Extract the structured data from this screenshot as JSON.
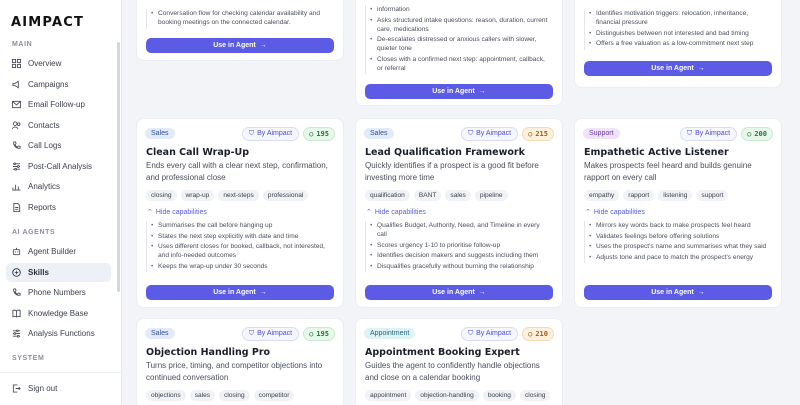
{
  "app": {
    "logo": "AIMPACT"
  },
  "sidebar": {
    "sections": {
      "main": "MAIN",
      "ai_agents": "AI AGENTS",
      "system": "SYSTEM"
    },
    "main_items": [
      {
        "label": "Overview",
        "icon": "grid-icon"
      },
      {
        "label": "Campaigns",
        "icon": "megaphone-icon"
      },
      {
        "label": "Email Follow-up",
        "icon": "mail-icon"
      },
      {
        "label": "Contacts",
        "icon": "users-icon"
      },
      {
        "label": "Call Logs",
        "icon": "phone-icon"
      },
      {
        "label": "Post-Call Analysis",
        "icon": "sliders-icon"
      },
      {
        "label": "Analytics",
        "icon": "chart-icon"
      },
      {
        "label": "Reports",
        "icon": "document-icon"
      }
    ],
    "agent_items": [
      {
        "label": "Agent Builder",
        "icon": "bot-icon"
      },
      {
        "label": "Skills",
        "icon": "sparkle-icon",
        "active": true
      },
      {
        "label": "Phone Numbers",
        "icon": "phone-icon"
      },
      {
        "label": "Knowledge Base",
        "icon": "book-icon"
      },
      {
        "label": "Analysis Functions",
        "icon": "function-icon"
      }
    ],
    "sign_out": "Sign out"
  },
  "top_cards": [
    {
      "caps": [
        "Conversation flow for checking calendar availability and booking meetings on the connected calendar."
      ],
      "button": "Use in Agent"
    },
    {
      "caps": [
        "information",
        "Asks structured intake questions: reason, duration, current care, medications",
        "De-escalates distressed or anxious callers with slower, quieter tone",
        "Closes with a confirmed next step: appointment, callback, or referral"
      ],
      "button": "Use in Agent"
    },
    {
      "caps": [
        "Identifies motivation triggers: relocation, inheritance, financial pressure",
        "Distinguishes between not interested and bad timing",
        "Offers a free valuation as a low-commitment next step"
      ],
      "button": "Use in Agent"
    }
  ],
  "cards": [
    {
      "category": "Sales",
      "by": "By Aimpact",
      "score": "195",
      "title": "Clean Call Wrap-Up",
      "description": "Ends every call with a clear next step, confirmation, and professional close",
      "tags": [
        "closing",
        "wrap-up",
        "next-steps",
        "professional"
      ],
      "hide_caps": "Hide capabilities",
      "caps": [
        "Summarises the call before hanging up",
        "States the next step explicitly with date and time",
        "Uses different closes for booked, callback, not interested, and info-needed outcomes",
        "Keeps the wrap-up under 30 seconds"
      ],
      "button": "Use in Agent"
    },
    {
      "category": "Sales",
      "by": "By Aimpact",
      "score": "215",
      "title": "Lead Qualification Framework",
      "description": "Quickly identifies if a prospect is a good fit before investing more time",
      "tags": [
        "qualification",
        "BANT",
        "sales",
        "pipeline"
      ],
      "hide_caps": "Hide capabilities",
      "caps": [
        "Qualifies Budget, Authority, Need, and Timeline in every call",
        "Scores urgency 1-10 to prioritise follow-up",
        "Identifies decision makers and suggests including them",
        "Disqualifies gracefully without burning the relationship"
      ],
      "button": "Use in Agent"
    },
    {
      "category": "Support",
      "by": "By Aimpact",
      "score": "200",
      "title": "Empathetic Active Listener",
      "description": "Makes prospects feel heard and builds genuine rapport on every call",
      "tags": [
        "empathy",
        "rapport",
        "listening",
        "support"
      ],
      "hide_caps": "Hide capabilities",
      "caps": [
        "Mirrors key words back to make prospects feel heard",
        "Validates feelings before offering solutions",
        "Uses the prospect's name and summarises what they said",
        "Adjusts tone and pace to match the prospect's energy"
      ],
      "button": "Use in Agent"
    },
    {
      "category": "Sales",
      "by": "By Aimpact",
      "score": "195",
      "title": "Objection Handling Pro",
      "description": "Turns price, timing, and competitor objections into continued conversation",
      "tags": [
        "objections",
        "sales",
        "closing",
        "competitor"
      ]
    },
    {
      "category": "Appointment",
      "by": "By Aimpact",
      "score": "210",
      "title": "Appointment Booking Expert",
      "description": "Guides the agent to confidently handle objections and close on a calendar booking",
      "tags": [
        "appointment",
        "objection-handling",
        "booking",
        "closing"
      ]
    }
  ]
}
